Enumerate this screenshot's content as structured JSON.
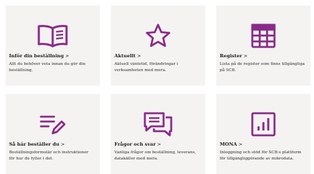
{
  "accent_color": "#8a2a8a",
  "cards": [
    {
      "title": "Inför din beställning",
      "chevron": ">",
      "description": "Allt du behöver veta innan du gör din beställning.",
      "icon": "open-book-icon"
    },
    {
      "title": "Aktuellt",
      "chevron": ">",
      "description": "Aktuell väntetid, förändringar i verksamheten med mera.",
      "icon": "star-icon"
    },
    {
      "title": "Register",
      "chevron": ">",
      "description": "Lista på de register som finns tillgängliga på SCB.",
      "icon": "table-icon"
    },
    {
      "title": "Så här beställer du",
      "chevron": ">",
      "description": "Beställningsformulär och instruktioner för hur du fyller i det.",
      "icon": "edit-list-icon"
    },
    {
      "title": "Frågor och svar",
      "chevron": ">",
      "description": "Vanliga frågor om beställning, leverans, datakällor med mera.",
      "icon": "chat-bubbles-icon"
    },
    {
      "title": "MONA",
      "chevron": ">",
      "description": "Inloggning och stöd för SCB:s plattform för tillgängliggörande av mikrodata.",
      "icon": "bar-chart-icon"
    }
  ]
}
